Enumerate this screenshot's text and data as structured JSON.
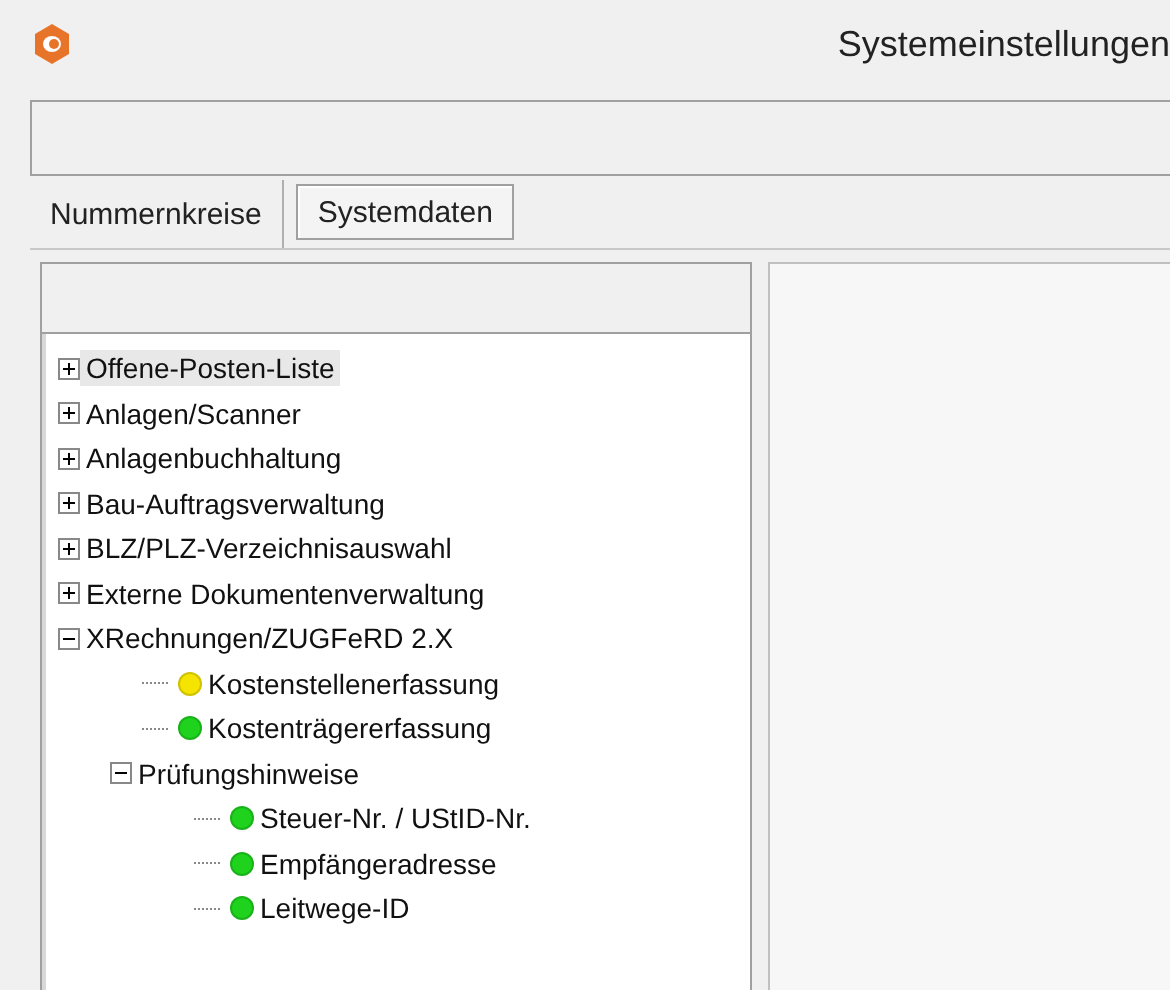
{
  "window": {
    "title": "Systemeinstellungen"
  },
  "tabs": [
    {
      "label": "Nummernkreise",
      "selected": false
    },
    {
      "label": "Systemdaten",
      "selected": true
    }
  ],
  "tree": [
    {
      "label": "Offene-Posten-Liste",
      "expanded": false,
      "selected": true
    },
    {
      "label": "Anlagen/Scanner",
      "expanded": false,
      "selected": false
    },
    {
      "label": "Anlagenbuchhaltung",
      "expanded": false,
      "selected": false
    },
    {
      "label": "Bau-Auftragsverwaltung",
      "expanded": false,
      "selected": false
    },
    {
      "label": "BLZ/PLZ-Verzeichnisauswahl",
      "expanded": false,
      "selected": false
    },
    {
      "label": "Externe Dokumentenverwaltung",
      "expanded": false,
      "selected": false
    },
    {
      "label": "XRechnungen/ZUGFeRD 2.X",
      "expanded": true,
      "selected": false,
      "children": [
        {
          "label": "Kostenstellenerfassung",
          "color": "#f5e400",
          "selected": false
        },
        {
          "label": "Kostenträgererfassung",
          "color": "#1ed21e",
          "selected": false
        },
        {
          "label": "Prüfungshinweise",
          "expanded": true,
          "selected": false,
          "children": [
            {
              "label": "Steuer-Nr. / UStID-Nr.",
              "color": "#1ed21e",
              "selected": false
            },
            {
              "label": "Empfängeradresse",
              "color": "#1ed21e",
              "selected": false
            },
            {
              "label": "Leitwege-ID",
              "color": "#1ed21e",
              "selected": false
            }
          ]
        }
      ]
    }
  ]
}
